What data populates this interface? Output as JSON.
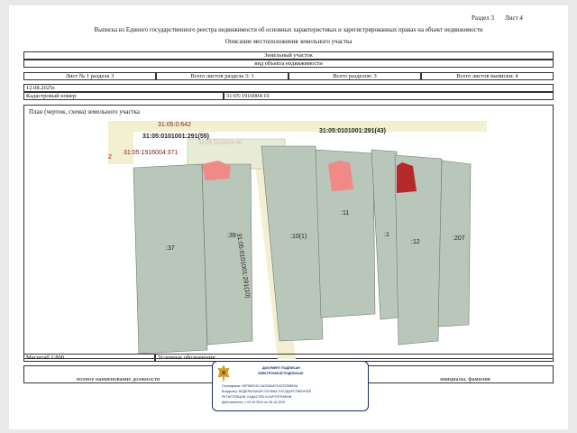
{
  "header": {
    "section_label": "Раздел 3",
    "sheet_label": "Лист 4",
    "title": "Выписка из Единого государственного реестра недвижимости об основных характеристиках и зарегистрированных правах на объект недвижимости",
    "subtitle": "Описание местоположения земельного участка"
  },
  "object": {
    "type": "Земельный участок",
    "type_caption": "вид объекта недвижимости"
  },
  "sheet_row": {
    "sheet_no": "Лист № 1 раздела 3",
    "total_sheets_section": "Всего листов раздела 3: 1",
    "total_sections": "Всего разделов: 3",
    "total_sheets": "Всего листов выписки: 4"
  },
  "date": "12.08.2025г.",
  "cadastral": {
    "label": "Кадастровый номер:",
    "value": "31:05:1916004:10"
  },
  "plan": {
    "title": "План (чертеж, схема) земельного участка",
    "labels": {
      "top_number": "31:05:0:642",
      "block_a": "31:05:0101001:291(55)",
      "block_b": "31:05:0101001:291(43)",
      "red_a": "31:05:1916004:371",
      "red_a_prefix": "2",
      "road_label": "31:05:0101001:291(10)",
      "faded": "31:05:1916004:40",
      "plot_37": ":37",
      "plot_39": ":39",
      "plot_10": ":10(1)",
      "plot_11": ":11",
      "plot_1": ":1",
      "plot_12": ":12",
      "plot_20": ":207"
    },
    "colors": {
      "plot_fill": "#b9c6ba",
      "plot_stroke": "#6f7a70",
      "road_fill": "#f3f0d2",
      "building_light": "#f08a86",
      "building_dark": "#b42a2a"
    }
  },
  "footer": {
    "scale": "Масштаб 1:800",
    "legend": "Условные обозначения:",
    "position_caption": "полное наименование должности",
    "initials_caption": "инициалы, фамилия"
  },
  "signature": {
    "title": "ДОКУМЕНТ ПОДПИСАН",
    "subtitle": "ЭЛЕКТРОННОЙ ПОДПИСЬЮ",
    "cert": "Сертификат: 00F9B0C5C1A0236A97C6237968E9A",
    "owner": "Владелец: ФЕДЕРАЛЬНАЯ СЛУЖБА ГОСУДАРСТВЕННОЙ",
    "owner2": "РЕГИСТРАЦИИ, КАДАСТРА И КАРТОГРАФИИ",
    "valid": "Действителен: с 02.04.2024 по 26.10.2025"
  }
}
